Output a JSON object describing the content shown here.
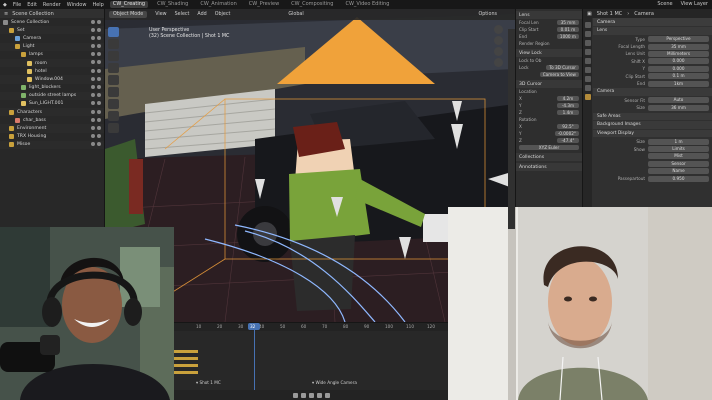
{
  "topbar": {
    "menus": [
      "File",
      "Edit",
      "Render",
      "Window",
      "Help"
    ],
    "workspaces": [
      "CW_Creating",
      "CW_Shading",
      "CW_Animation",
      "CW_Preview",
      "CW_Compositing",
      "CW_Video Editing"
    ],
    "active_workspace": "CW_Creating",
    "right": [
      "Scene",
      "View Layer"
    ]
  },
  "outliner": {
    "header": "Scene Collection",
    "rows": [
      {
        "label": "Scene Collection",
        "indent": 0,
        "color": "#8a8a8a"
      },
      {
        "label": "Set",
        "indent": 1,
        "color": "#c9a13c"
      },
      {
        "label": "Camera",
        "indent": 2,
        "color": "#6aa0d8"
      },
      {
        "label": "Light",
        "indent": 2,
        "color": "#c9a13c"
      },
      {
        "label": "lamps",
        "indent": 3,
        "color": "#c9a13c"
      },
      {
        "label": "room",
        "indent": 4,
        "color": "#e0c060"
      },
      {
        "label": "hotel",
        "indent": 4,
        "color": "#e0c060"
      },
      {
        "label": "Window.004",
        "indent": 4,
        "color": "#e0c060"
      },
      {
        "label": "light_blockers",
        "indent": 3,
        "color": "#7fb36a"
      },
      {
        "label": "outside street lamps",
        "indent": 3,
        "color": "#7fb36a"
      },
      {
        "label": "Sun_LIGHT.001",
        "indent": 3,
        "color": "#e0c060"
      },
      {
        "label": "Characters",
        "indent": 1,
        "color": "#c9a13c"
      },
      {
        "label": "char_bass",
        "indent": 2,
        "color": "#d87a6a"
      },
      {
        "label": "Environment",
        "indent": 1,
        "color": "#c9a13c"
      },
      {
        "label": "TRX Housing",
        "indent": 1,
        "color": "#c9a13c"
      },
      {
        "label": "Misoe",
        "indent": 1,
        "color": "#c9a13c"
      }
    ]
  },
  "viewport": {
    "header": [
      "Object Mode",
      "View",
      "Select",
      "Add",
      "Object",
      "Global",
      "Options"
    ],
    "info_line1": "User Perspective",
    "info_line2": "(32) Scene Collection | Shot 1 MC"
  },
  "sidepanel": {
    "lens_section": "Lens",
    "rows": [
      {
        "k": "Focal Len",
        "v": "35 mm"
      },
      {
        "k": "Clip Start",
        "v": "0.01 m"
      },
      {
        "k": "End",
        "v": "1000 m"
      }
    ],
    "render_region": "Render Region",
    "view_lock": "View Lock",
    "lock_rows": [
      {
        "k": "Lock to Ob",
        "v": ""
      },
      {
        "k": "Lock",
        "v": "To 3D Cursor"
      },
      {
        "k": "",
        "v": "Camera to View"
      }
    ],
    "cursor_section": "3D Cursor",
    "location_label": "Location",
    "location": [
      {
        "k": "X",
        "v": "4.2m"
      },
      {
        "k": "Y",
        "v": "-4.3m"
      },
      {
        "k": "Z",
        "v": "1.4m"
      }
    ],
    "rotation_label": "Rotation",
    "rotation": [
      {
        "k": "X",
        "v": "92.5°"
      },
      {
        "k": "Y",
        "v": "-0.0002°"
      },
      {
        "k": "Z",
        "v": "-47.4°"
      }
    ],
    "rotation_mode": "XYZ Euler",
    "collections": "Collections",
    "annotations": "Annotations"
  },
  "props": {
    "header": [
      "Shot 1 MC",
      "Camera"
    ],
    "object_tag": "Camera",
    "lens_section": "Lens",
    "lens": [
      {
        "k": "Type",
        "v": "Perspective"
      },
      {
        "k": "Focal Length",
        "v": "35 mm"
      },
      {
        "k": "Lens Unit",
        "v": "Millimeters"
      },
      {
        "k": "Shift X",
        "v": "0.000"
      },
      {
        "k": "Y",
        "v": "0.000"
      },
      {
        "k": "Clip Start",
        "v": "0.1 m"
      },
      {
        "k": "End",
        "v": "1km"
      }
    ],
    "camera_section": "Camera",
    "camera": [
      {
        "k": "Sensor Fit",
        "v": "Auto"
      },
      {
        "k": "Size",
        "v": "36 mm"
      }
    ],
    "safe_areas": "Safe Areas",
    "background_images": "Background Images",
    "viewport_display": "Viewport Display",
    "display": [
      {
        "k": "Size",
        "v": "1 m"
      },
      {
        "k": "Show",
        "v": "Limits"
      },
      {
        "k": "",
        "v": "Mist"
      },
      {
        "k": "",
        "v": "Sensor"
      },
      {
        "k": "",
        "v": "Name"
      },
      {
        "k": "Passepartout",
        "v": "0.950"
      }
    ]
  },
  "timeline": {
    "ticks": [
      "10",
      "20",
      "30",
      "40",
      "50",
      "60",
      "70",
      "80",
      "90",
      "100",
      "110",
      "120"
    ],
    "current_frame": "32",
    "markers": [
      "Shot 1 MC",
      "Wide Angle Camera"
    ]
  }
}
